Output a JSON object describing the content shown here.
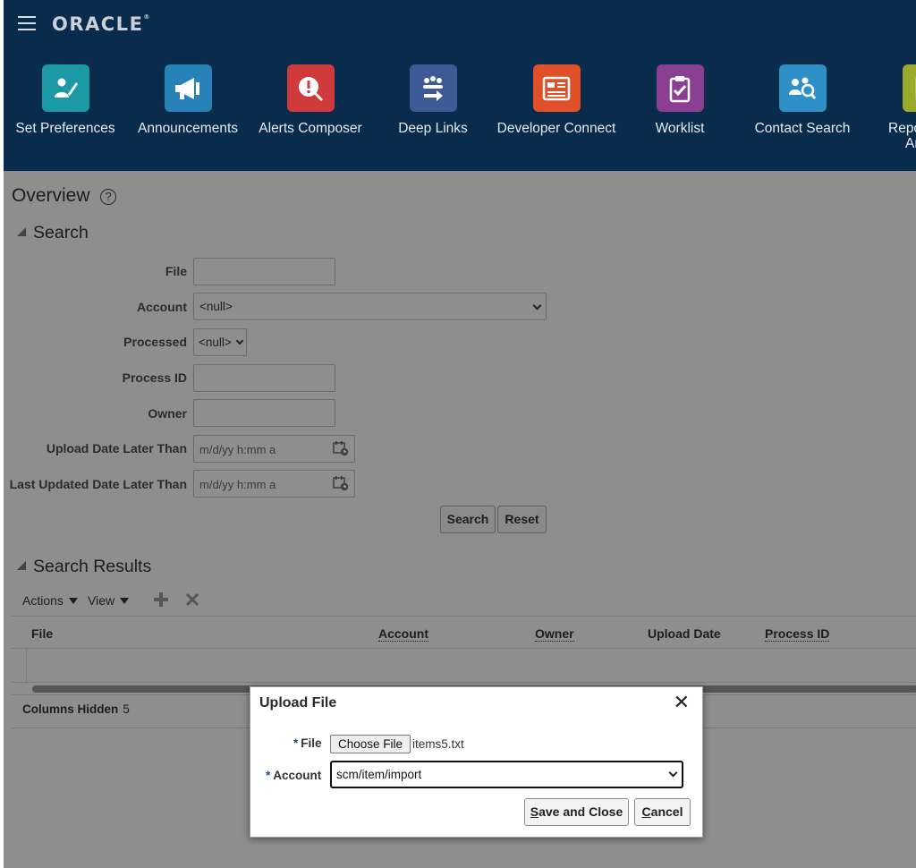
{
  "header": {
    "logo": "ORACLE",
    "apps": [
      {
        "label": "Set Preferences",
        "icon": "set-preferences-icon",
        "color": "#1b9aa5"
      },
      {
        "label": "Announcements",
        "icon": "megaphone-icon",
        "color": "#2782b8"
      },
      {
        "label": "Alerts Composer",
        "icon": "alert-wrench-icon",
        "color": "#cf3b3b"
      },
      {
        "label": "Deep Links",
        "icon": "deep-links-icon",
        "color": "#3e5a96"
      },
      {
        "label": "Developer Connect",
        "icon": "developer-connect-icon",
        "color": "#e0512a"
      },
      {
        "label": "Worklist",
        "icon": "clipboard-check-icon",
        "color": "#8b3f93"
      },
      {
        "label": "Contact Search",
        "icon": "contact-search-icon",
        "color": "#2f8fc7"
      },
      {
        "label": "Repo",
        "label2": "Ana",
        "icon": "reports-icon",
        "color": "#9aab2c"
      }
    ]
  },
  "overview": {
    "title": "Overview"
  },
  "search": {
    "heading": "Search",
    "file_label": "File",
    "account_label": "Account",
    "account_value": "<null>",
    "processed_label": "Processed",
    "processed_value": "<null>",
    "process_id_label": "Process ID",
    "owner_label": "Owner",
    "upload_date_label": "Upload Date Later Than",
    "upload_date_placeholder": "m/d/yy h:mm a",
    "last_updated_label": "Last Updated Date Later Than",
    "last_updated_placeholder": "m/d/yy h:mm a",
    "search_button": "Search",
    "reset_button": "Reset"
  },
  "results": {
    "heading": "Search Results",
    "actions_label": "Actions",
    "view_label": "View",
    "columns": [
      "File",
      "Account",
      "Owner",
      "Upload Date",
      "Process ID"
    ],
    "columns_hidden_label": "Columns Hidden",
    "columns_hidden_count": "5"
  },
  "dialog": {
    "title": "Upload File",
    "file_label": "File",
    "choose_file_button": "Choose File",
    "file_name": "items5.txt",
    "account_label": "Account",
    "account_value": "scm/item/import",
    "save_close_first": "S",
    "save_close_rest": "ave and Close",
    "cancel_first": "C",
    "cancel_rest": "ancel",
    "required_mark": "*"
  }
}
